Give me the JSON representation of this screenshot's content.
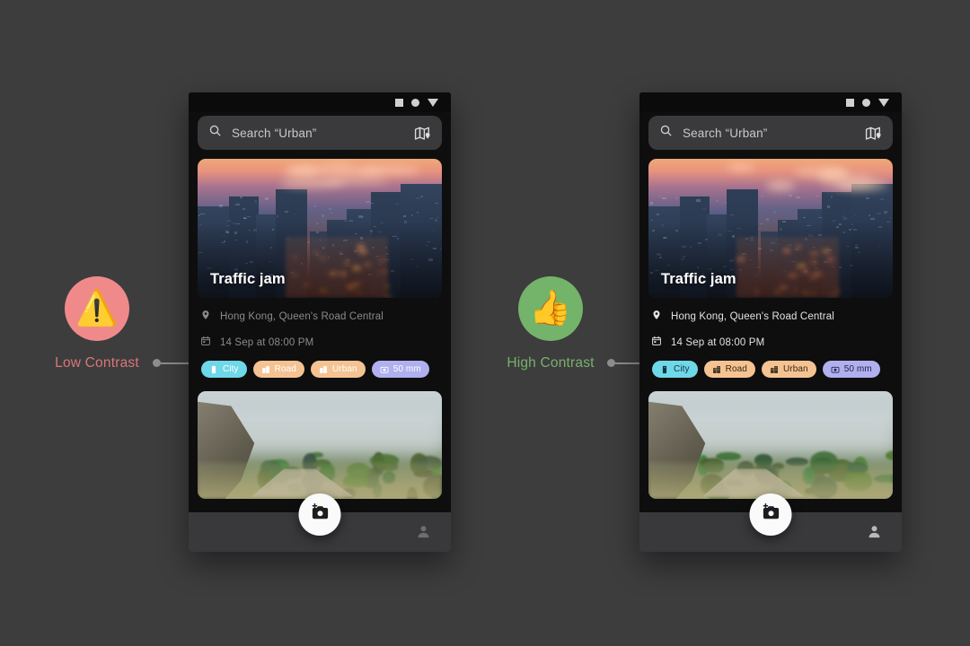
{
  "background_color": "#3d3d3d",
  "annotations": [
    {
      "id": "low-contrast",
      "badge_icon": "warning-emoji",
      "badge_glyph": "⚠️",
      "badge_bg": "#f08a8a",
      "label": "Low Contrast",
      "label_color": "#d9767a"
    },
    {
      "id": "high-contrast",
      "badge_icon": "thumbs-up-emoji",
      "badge_glyph": "👍",
      "badge_bg": "#74b36a",
      "label": "High Contrast",
      "label_color": "#79b06e"
    }
  ],
  "connector_color": "#8e8e8e",
  "phones": [
    {
      "variant": "low-contrast",
      "statusbar": {
        "icons": [
          "square-icon",
          "circle-icon",
          "triangle-down-icon"
        ]
      },
      "search": {
        "placeholder": "Search “Urban”",
        "icon": "search-icon",
        "action_icon": "map-pin-icon"
      },
      "card": {
        "title": "Traffic jam",
        "image": "city-sunset-photo",
        "location": "Hong Kong, Queen's Road Central",
        "location_icon": "location-pin-icon",
        "datetime": "14 Sep at 08:00 PM",
        "datetime_icon": "calendar-icon",
        "meta_text_color": "#8b8b8f"
      },
      "tags": [
        {
          "label": "City",
          "icon": "tag-icon",
          "bg": "#6fd8e8",
          "fg": "#ffffff"
        },
        {
          "label": "Road",
          "icon": "city-icon",
          "bg": "#f5c392",
          "fg": "#ffffff"
        },
        {
          "label": "Urban",
          "icon": "city-icon",
          "bg": "#f5c392",
          "fg": "#ffffff"
        },
        {
          "label": "50 mm",
          "icon": "camera-icon",
          "bg": "#b0b0ef",
          "fg": "#ffffff"
        }
      ],
      "card2": {
        "image": "misty-mountain-photo"
      },
      "bottombar": {
        "fab_icon": "add-photo-camera-icon",
        "profile_icon": "person-icon",
        "profile_color": "#6e6e72"
      }
    },
    {
      "variant": "high-contrast",
      "statusbar": {
        "icons": [
          "square-icon",
          "circle-icon",
          "triangle-down-icon"
        ]
      },
      "search": {
        "placeholder": "Search “Urban”",
        "icon": "search-icon",
        "action_icon": "map-pin-icon"
      },
      "card": {
        "title": "Traffic jam",
        "image": "city-sunset-photo",
        "location": "Hong Kong, Queen's Road Central",
        "location_icon": "location-pin-icon",
        "datetime": "14 Sep at 08:00 PM",
        "datetime_icon": "calendar-icon",
        "meta_text_color": "#e3e3e6"
      },
      "tags": [
        {
          "label": "City",
          "icon": "tag-icon",
          "bg": "#6fd8e8",
          "fg": "#15333a"
        },
        {
          "label": "Road",
          "icon": "city-icon",
          "bg": "#f5c392",
          "fg": "#3b2a16"
        },
        {
          "label": "Urban",
          "icon": "city-icon",
          "bg": "#f5c392",
          "fg": "#3b2a16"
        },
        {
          "label": "50 mm",
          "icon": "camera-icon",
          "bg": "#b0b0ef",
          "fg": "#23234a"
        }
      ],
      "card2": {
        "image": "misty-mountain-photo"
      },
      "bottombar": {
        "fab_icon": "add-photo-camera-icon",
        "profile_icon": "person-icon",
        "profile_color": "#b9b9bd"
      }
    }
  ]
}
